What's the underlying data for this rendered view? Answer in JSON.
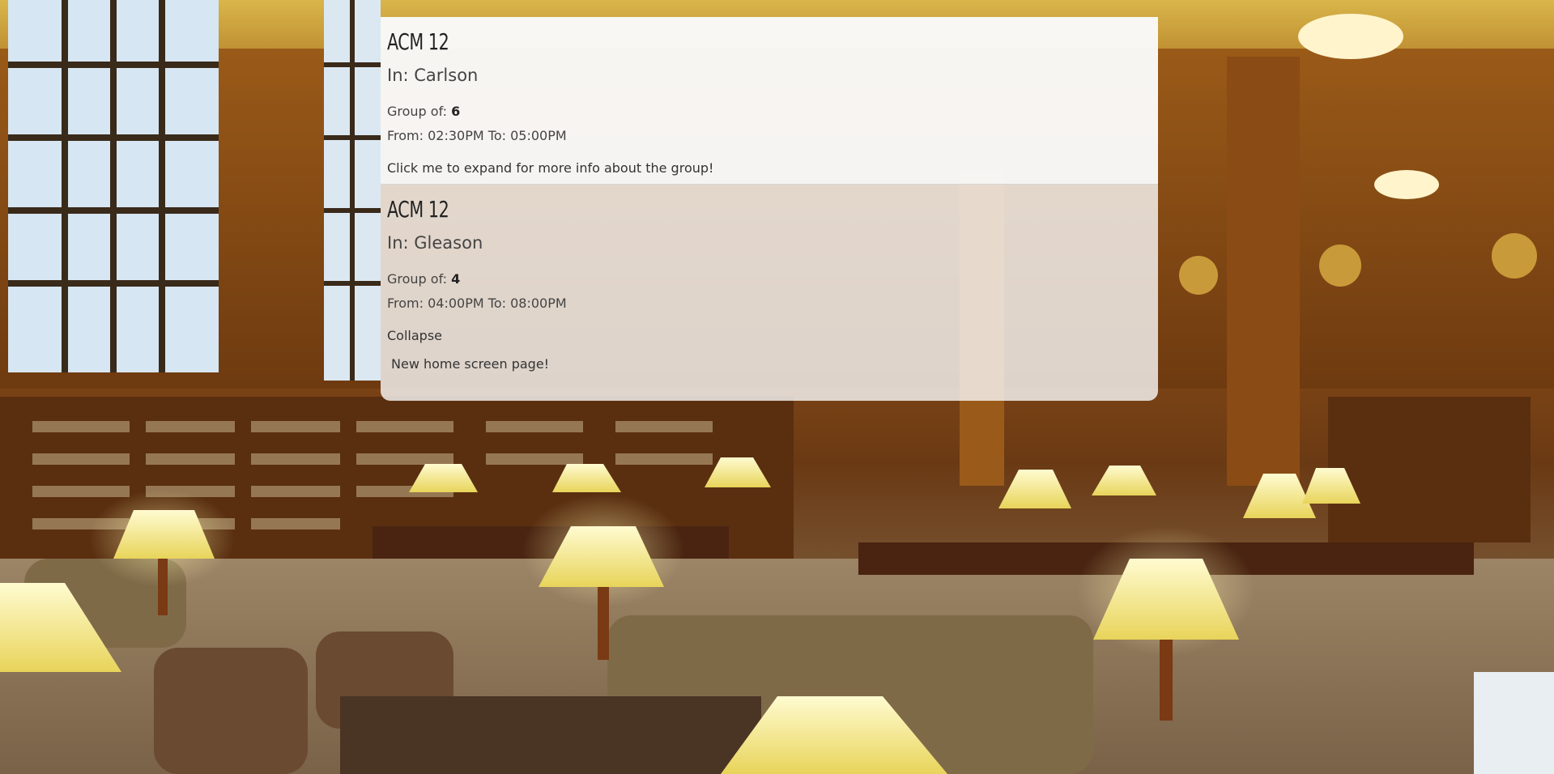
{
  "cards": [
    {
      "title": "ACM 12",
      "location_label": "In: ",
      "location": "Carlson",
      "group_label": "Group of: ",
      "group_size": "6",
      "from_label": "From: ",
      "from_time": "02:30PM",
      "to_label": " To: ",
      "to_time": "05:00PM",
      "expand_text": "Click me to expand for more info about the group!"
    },
    {
      "title": "ACM 12",
      "location_label": "In: ",
      "location": "Gleason",
      "group_label": "Group of: ",
      "group_size": "4",
      "from_label": "From: ",
      "from_time": "04:00PM",
      "to_label": " To: ",
      "to_time": "08:00PM",
      "collapse_text": "Collapse",
      "info_text": "New home screen page!"
    }
  ],
  "colors": {
    "card_bg": "#fafafa",
    "text": "#444444",
    "wood": "#7a4516",
    "lamp": "#f6ec9a"
  }
}
